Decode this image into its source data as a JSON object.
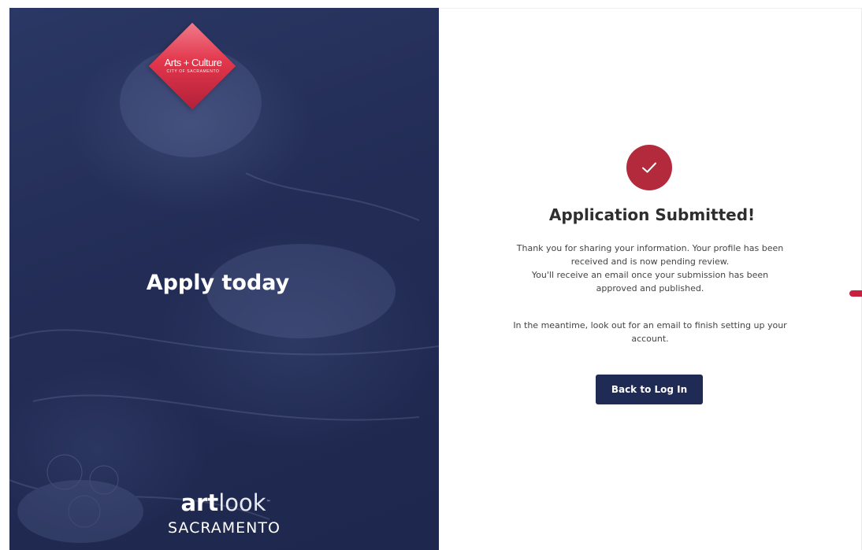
{
  "left_panel": {
    "logo": {
      "name": "Arts + Culture",
      "subline": "CITY OF SACRAMENTO"
    },
    "headline": "Apply today",
    "brand": {
      "word_bold": "art",
      "word_light": "look",
      "trademark": "™",
      "city": "SACRAMENTO"
    }
  },
  "confirmation": {
    "icon": "check-icon",
    "title": "Application Submitted!",
    "message_lines_1": [
      "Thank you for sharing your information. Your profile has been",
      "received and is now pending review.",
      "You'll receive an email once your submission has been",
      "approved and published."
    ],
    "message_lines_2": [
      "In the meantime, look out for an email to finish setting up your",
      "account."
    ],
    "back_button_label": "Back to Log In"
  },
  "colors": {
    "panel_navy": "#222c55",
    "button_navy": "#1f2b55",
    "accent_red": "#b42a3d",
    "logo_red": "#e2364b"
  }
}
